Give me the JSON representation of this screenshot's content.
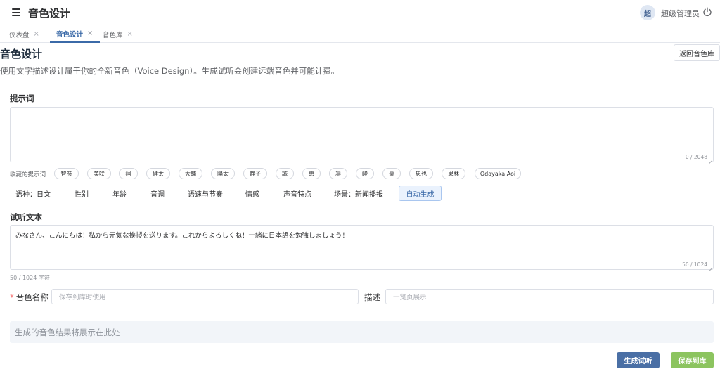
{
  "header": {
    "app_title": "音色设计",
    "avatar_text": "超",
    "user_name": "超级管理员",
    "icons": {
      "menu": "hamburger-icon",
      "logout": "power-icon"
    }
  },
  "tabs": [
    {
      "label": "仪表盘",
      "active": false
    },
    {
      "label": "音色设计",
      "active": true
    },
    {
      "label": "音色库",
      "active": false
    }
  ],
  "tab_close_glyph": "×",
  "page": {
    "title": "音色设计",
    "back_button": "返回音色库",
    "description": "使用文字描述设计属于你的全新音色（Voice Design）。生成试听会创建远端音色并可能计费。"
  },
  "prompt": {
    "label": "提示词",
    "value": "",
    "counter": "0 / 2048"
  },
  "favorites": {
    "label": "收藏的提示词",
    "items": [
      "智彦",
      "美咲",
      "翔",
      "健太",
      "大輔",
      "陽太",
      "静子",
      "誠",
      "恵",
      "凛",
      "峻",
      "豪",
      "忠也",
      "果林",
      "Odayaka Aoi"
    ]
  },
  "filters": [
    {
      "label": "语种：日文",
      "active": false
    },
    {
      "label": "性别",
      "active": false
    },
    {
      "label": "年龄",
      "active": false
    },
    {
      "label": "音调",
      "active": false
    },
    {
      "label": "语速与节奏",
      "active": false
    },
    {
      "label": "情感",
      "active": false
    },
    {
      "label": "声音特点",
      "active": false
    },
    {
      "label": "场景：新闻播报",
      "active": false
    },
    {
      "label": "自动生成",
      "active": true
    }
  ],
  "preview_text": {
    "label": "试听文本",
    "value": "みなさん、こんにちは！私から元気な挨拶を送ります。これからよろしくね！一緒に日本語を勉強しましょう！",
    "counter": "50 / 1024",
    "char_count": "50 / 1024 字符"
  },
  "voice_name": {
    "required_mark": "*",
    "label": "音色名称",
    "placeholder": "保存到库时使用"
  },
  "description_field": {
    "label": "描述",
    "placeholder": "一览页展示"
  },
  "result_placeholder": "生成的音色结果将展示在此处",
  "actions": {
    "generate": "生成试听",
    "save": "保存到库"
  },
  "colors": {
    "primary": "#4a6fa5",
    "success": "#8cc45f",
    "active_tab": "#3b6aa8",
    "required": "#f56c6c"
  }
}
